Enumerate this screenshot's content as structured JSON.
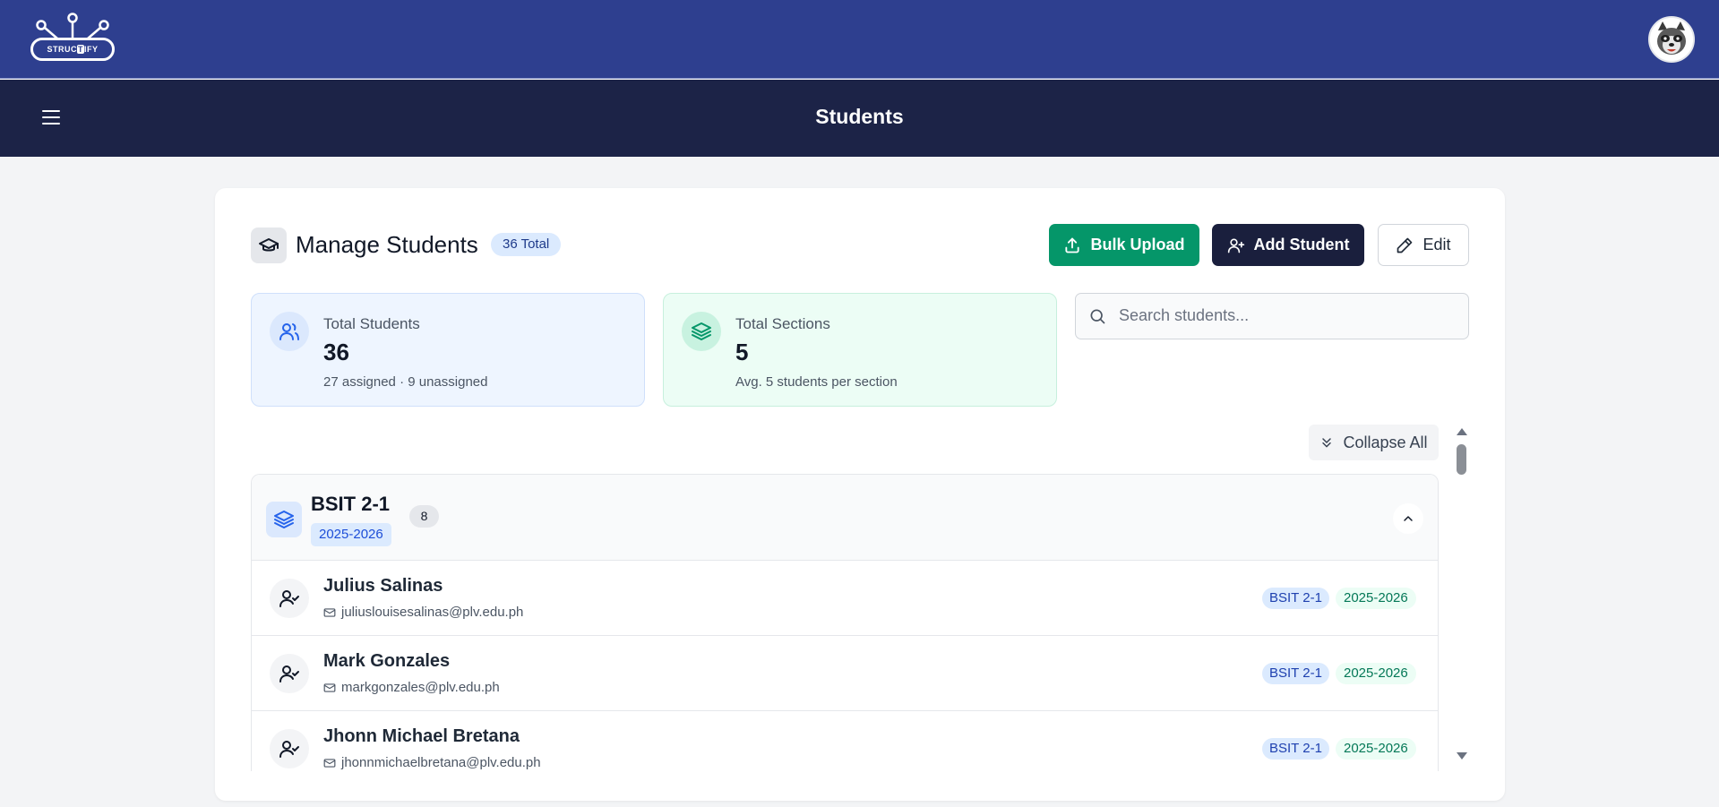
{
  "header": {
    "logo_text_a": "STRUC",
    "logo_text_b": "T",
    "logo_text_c": "IFY",
    "page_title": "Students"
  },
  "manage": {
    "title": "Manage Students",
    "total_badge": "36 Total"
  },
  "actions": {
    "bulk_upload": "Bulk Upload",
    "add_student": "Add Student",
    "edit": "Edit"
  },
  "stats": {
    "students": {
      "label": "Total Students",
      "value": "36",
      "sub": "27 assigned · 9 unassigned"
    },
    "sections": {
      "label": "Total Sections",
      "value": "5",
      "sub": "Avg. 5 students per section"
    }
  },
  "search": {
    "placeholder": "Search students...",
    "value": ""
  },
  "collapse_label": "Collapse All",
  "section": {
    "name": "BSIT 2-1",
    "year": "2025-2026",
    "count": "8",
    "students": [
      {
        "name": "Julius Salinas",
        "email": "juliuslouisesalinas@plv.edu.ph",
        "section": "BSIT 2-1",
        "year": "2025-2026"
      },
      {
        "name": "Mark Gonzales",
        "email": "markgonzales@plv.edu.ph",
        "section": "BSIT 2-1",
        "year": "2025-2026"
      },
      {
        "name": "Jhonn Michael Bretana",
        "email": "jhonnmichaelbretana@plv.edu.ph",
        "section": "BSIT 2-1",
        "year": "2025-2026"
      }
    ]
  },
  "colors": {
    "topbar": "#2e3f8f",
    "subbar": "#1c2347",
    "bulk": "#059669",
    "add": "#1a1f3d"
  }
}
